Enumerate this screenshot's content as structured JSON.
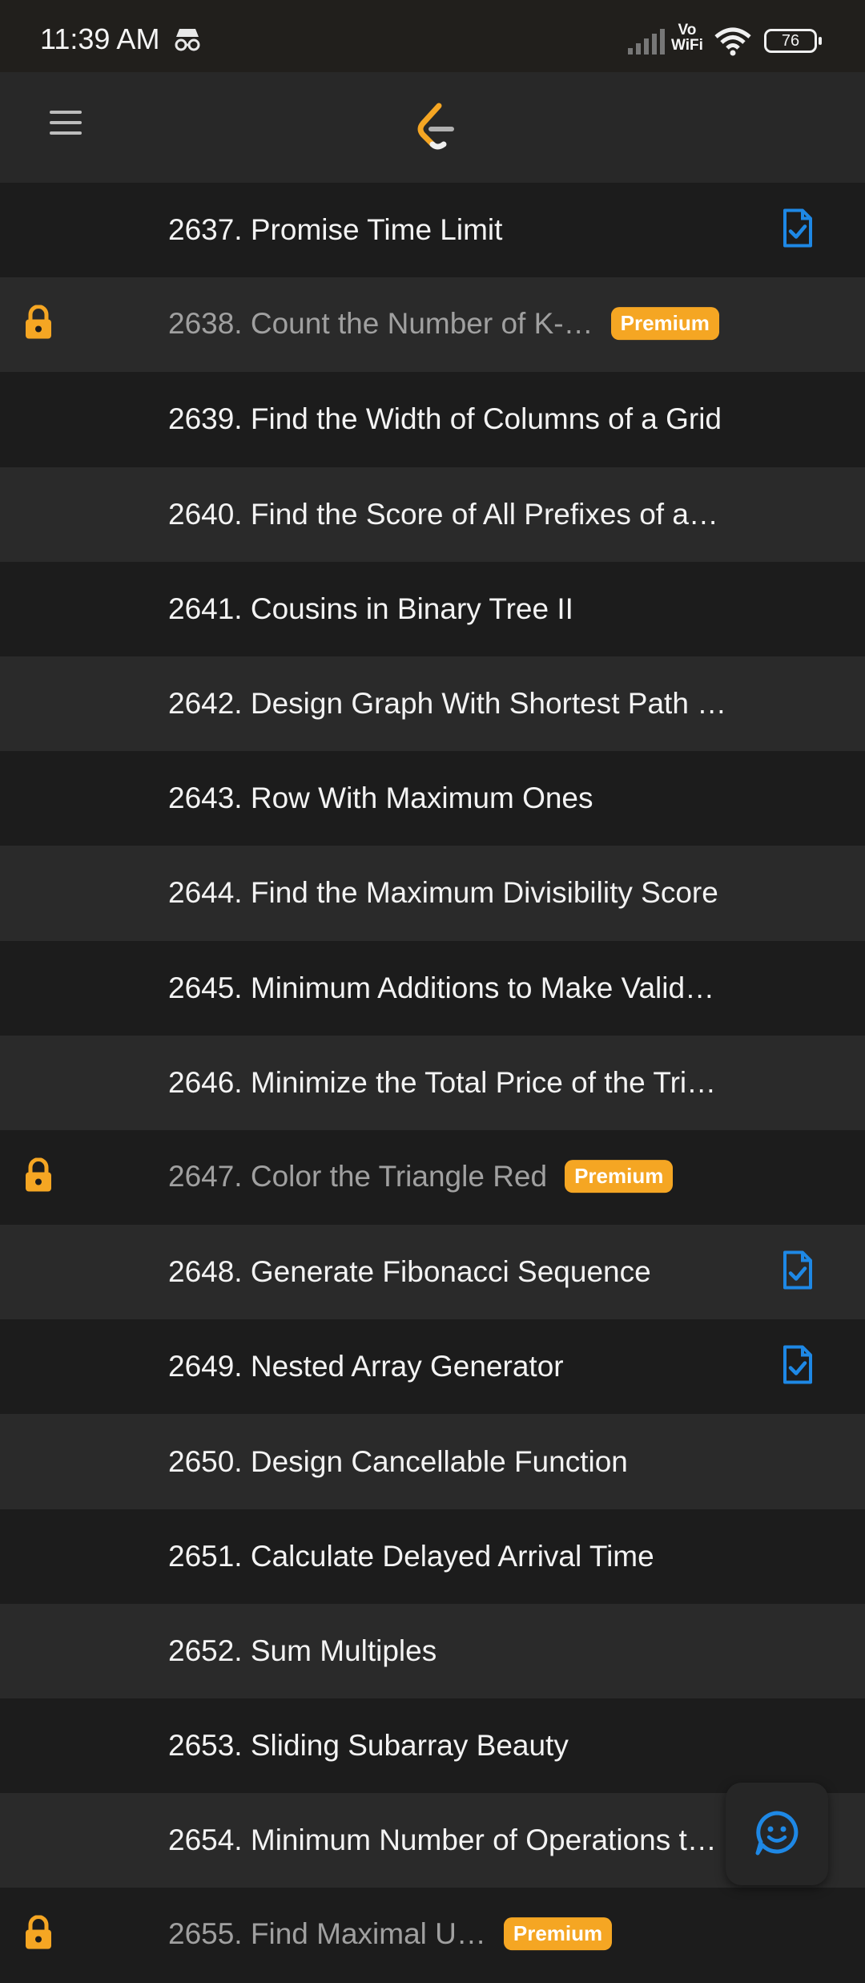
{
  "status_bar": {
    "time": "11:39 AM",
    "network_label_top": "Vo",
    "network_label_bottom": "WiFi",
    "battery": "76"
  },
  "header": {
    "menu_icon": "hamburger-menu-icon",
    "logo_icon": "leetcode-logo-icon"
  },
  "problems": [
    {
      "title": "2637. Promise Time Limit",
      "locked": false,
      "premium_label": "",
      "solved": true
    },
    {
      "title": "2638. Count the Number of K-…",
      "locked": true,
      "premium_label": "Premium",
      "solved": false
    },
    {
      "title": "2639. Find the Width of Columns of a Grid",
      "locked": false,
      "premium_label": "",
      "solved": false
    },
    {
      "title": "2640. Find the Score of All Prefixes of a…",
      "locked": false,
      "premium_label": "",
      "solved": false
    },
    {
      "title": "2641. Cousins in Binary Tree II",
      "locked": false,
      "premium_label": "",
      "solved": false
    },
    {
      "title": "2642. Design Graph With Shortest Path …",
      "locked": false,
      "premium_label": "",
      "solved": false
    },
    {
      "title": "2643. Row With Maximum Ones",
      "locked": false,
      "premium_label": "",
      "solved": false
    },
    {
      "title": "2644. Find the Maximum Divisibility Score",
      "locked": false,
      "premium_label": "",
      "solved": false
    },
    {
      "title": "2645. Minimum Additions to Make Valid…",
      "locked": false,
      "premium_label": "",
      "solved": false
    },
    {
      "title": "2646. Minimize the Total Price of the Tri…",
      "locked": false,
      "premium_label": "",
      "solved": false
    },
    {
      "title": "2647. Color the Triangle Red",
      "locked": true,
      "premium_label": "Premium",
      "solved": false
    },
    {
      "title": "2648. Generate Fibonacci Sequence",
      "locked": false,
      "premium_label": "",
      "solved": true
    },
    {
      "title": "2649. Nested Array Generator",
      "locked": false,
      "premium_label": "",
      "solved": true
    },
    {
      "title": "2650. Design Cancellable Function",
      "locked": false,
      "premium_label": "",
      "solved": false
    },
    {
      "title": "2651. Calculate Delayed Arrival Time",
      "locked": false,
      "premium_label": "",
      "solved": false
    },
    {
      "title": "2652. Sum Multiples",
      "locked": false,
      "premium_label": "",
      "solved": false
    },
    {
      "title": "2653. Sliding Subarray Beauty",
      "locked": false,
      "premium_label": "",
      "solved": false
    },
    {
      "title": "2654. Minimum Number of Operations t…",
      "locked": false,
      "premium_label": "",
      "solved": false
    },
    {
      "title": "2655. Find Maximal U…",
      "locked": true,
      "premium_label": "Premium",
      "solved": false
    }
  ],
  "fab": {
    "icon": "chat-smiley-icon"
  },
  "colors": {
    "accent_orange": "#f5a623",
    "solved_blue": "#1e88e5",
    "row_dark": "#1c1c1c",
    "row_light": "#2a2a2a"
  }
}
